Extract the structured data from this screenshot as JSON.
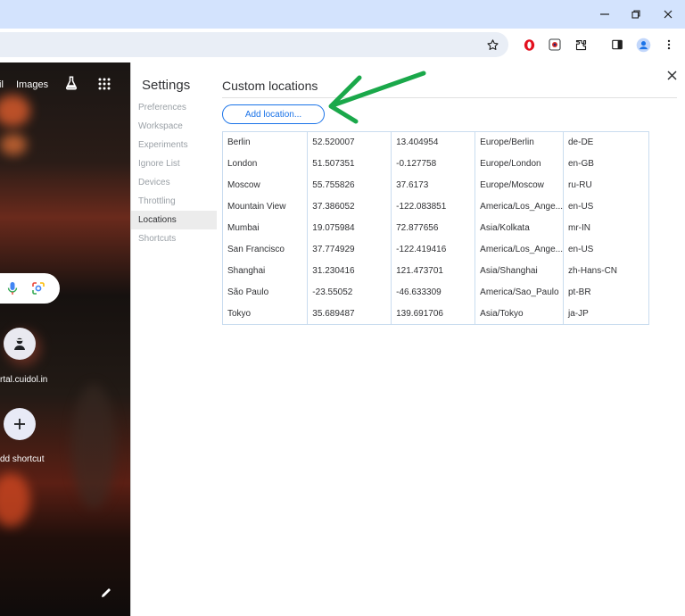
{
  "window": {
    "minimize_icon": "minimize-icon",
    "maximize_icon": "restore-icon",
    "close_icon": "close-icon"
  },
  "toolbar": {
    "icons": [
      "star-icon",
      "opera-icon",
      "extension-camera-icon",
      "puzzle-icon",
      "side-panel-icon",
      "profile-icon",
      "more-vert-icon"
    ]
  },
  "ntp": {
    "links": {
      "mail": "il",
      "images": "Images"
    },
    "shortcut_label": "rtal.cuidol.in",
    "add_shortcut_label": "dd shortcut"
  },
  "settings": {
    "title": "Settings",
    "nav": [
      "Preferences",
      "Workspace",
      "Experiments",
      "Ignore List",
      "Devices",
      "Throttling",
      "Locations",
      "Shortcuts"
    ],
    "selected_nav": "Locations",
    "section_title": "Custom locations",
    "add_button_label": "Add location...",
    "rows": [
      [
        "Berlin",
        "52.520007",
        "13.404954",
        "Europe/Berlin",
        "de-DE"
      ],
      [
        "London",
        "51.507351",
        "-0.127758",
        "Europe/London",
        "en-GB"
      ],
      [
        "Moscow",
        "55.755826",
        "37.6173",
        "Europe/Moscow",
        "ru-RU"
      ],
      [
        "Mountain View",
        "37.386052",
        "-122.083851",
        "America/Los_Ange...",
        "en-US"
      ],
      [
        "Mumbai",
        "19.075984",
        "72.877656",
        "Asia/Kolkata",
        "mr-IN"
      ],
      [
        "San Francisco",
        "37.774929",
        "-122.419416",
        "America/Los_Ange...",
        "en-US"
      ],
      [
        "Shanghai",
        "31.230416",
        "121.473701",
        "Asia/Shanghai",
        "zh-Hans-CN"
      ],
      [
        "São Paulo",
        "-23.55052",
        "-46.633309",
        "America/Sao_Paulo",
        "pt-BR"
      ],
      [
        "Tokyo",
        "35.689487",
        "139.691706",
        "Asia/Tokyo",
        "ja-JP"
      ]
    ]
  },
  "colors": {
    "accent": "#1a73e8",
    "annotation_arrow": "#1aa84a",
    "titlebar": "#d3e3fd"
  }
}
